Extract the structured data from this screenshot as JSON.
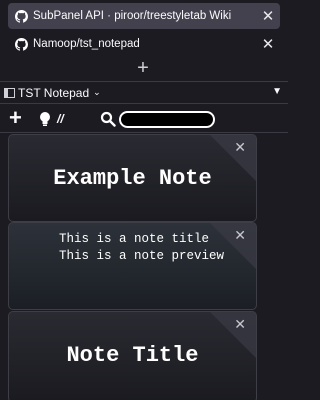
{
  "tabs": [
    {
      "title": "SubPanel API · piroor/treestyletab Wiki",
      "active": true
    },
    {
      "title": "Namoop/tst_notepad",
      "active": false
    }
  ],
  "panel": {
    "title": "TST Notepad",
    "chevron": "⌄",
    "menu": "▼"
  },
  "toolbar": {
    "add": "+",
    "slash": "//",
    "search_value": ""
  },
  "notes": [
    {
      "title": "Example Note",
      "close": "✕"
    },
    {
      "lines": [
        "This is a note title",
        "This is a note preview"
      ],
      "close": "✕"
    },
    {
      "title": "Note Title",
      "close": "✕"
    }
  ],
  "icons": {
    "close": "✕",
    "new_tab": "+"
  }
}
